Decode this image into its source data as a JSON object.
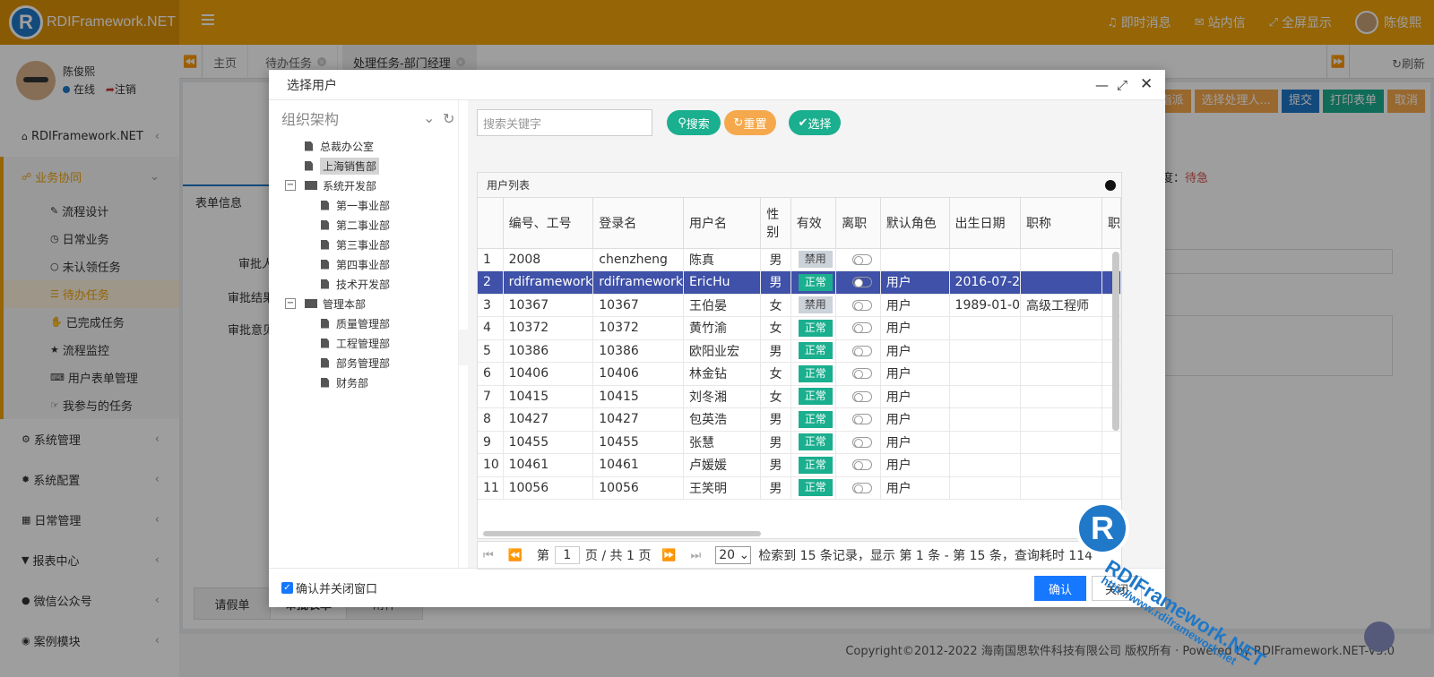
{
  "app": {
    "logo_letter": "R",
    "title": "RDIFramework.NET"
  },
  "top_nav": {
    "messages": "即时消息",
    "mail": "站内信",
    "fullscreen": "全屏显示",
    "user": "陈俊熙"
  },
  "user_panel": {
    "name": "陈俊熙",
    "status": "在线",
    "logout": "注销"
  },
  "sidebar": {
    "top_item": "RDIFramework.NET",
    "group": "业务协同",
    "sub_items": [
      "流程设计",
      "日常业务",
      "未认领任务",
      "待办任务",
      "已完成任务",
      "流程监控",
      "用户表单管理",
      "我参与的任务"
    ],
    "items": [
      "系统管理",
      "系统配置",
      "日常管理",
      "报表中心",
      "微信公众号",
      "案例模块"
    ]
  },
  "tabs": [
    "主页",
    "待办任务",
    "处理任务-部门经理"
  ],
  "refresh_label": "刷新",
  "content": {
    "buttons": [
      "指派",
      "选择处理人...",
      "提交",
      "打印表单",
      "取消"
    ],
    "form_tab": "表单信息",
    "priority_label": "度：",
    "priority_value": "待急",
    "labels": [
      "审批人",
      "审批结果",
      "审批意见"
    ],
    "bottom_tabs": [
      "请假单",
      "审批表单",
      "附件"
    ]
  },
  "footer": {
    "copyright": "Copyright©2012-2022 海南国思软件科技有限公司 版权所有 · Powered by RDIFramework.NET-V5.0"
  },
  "modal": {
    "title": "选择用户",
    "org_title": "组织架构",
    "tree": {
      "root_docs": [
        "总裁办公室",
        "上海销售部"
      ],
      "dev": {
        "name": "系统开发部",
        "children": [
          "第一事业部",
          "第二事业部",
          "第三事业部",
          "第四事业部",
          "技术开发部"
        ]
      },
      "mgmt": {
        "name": "管理本部",
        "children": [
          "质量管理部",
          "工程管理部",
          "部务管理部",
          "财务部"
        ]
      }
    },
    "search": {
      "placeholder": "搜索关键字",
      "search_btn": "搜索",
      "reset_btn": "重置",
      "select_btn": "选择"
    },
    "grid": {
      "title": "用户列表",
      "columns": [
        "",
        "编号、工号",
        "登录名",
        "用户名",
        "性别",
        "有效",
        "离职",
        "默认角色",
        "出生日期",
        "职称",
        "职"
      ],
      "rows": [
        [
          "1",
          "2008",
          "chenzheng",
          "陈真",
          "男",
          "禁用",
          "",
          "",
          ""
        ],
        [
          "2",
          "rdiframework",
          "rdiframework",
          "EricHu",
          "男",
          "正常",
          "用户",
          "2016-07-2",
          ""
        ],
        [
          "3",
          "10367",
          "10367",
          "王伯晏",
          "女",
          "禁用",
          "用户",
          "1989-01-0",
          "高级工程师"
        ],
        [
          "4",
          "10372",
          "10372",
          "黄竹渝",
          "女",
          "正常",
          "用户",
          "",
          ""
        ],
        [
          "5",
          "10386",
          "10386",
          "欧阳业宏",
          "男",
          "正常",
          "用户",
          "",
          ""
        ],
        [
          "6",
          "10406",
          "10406",
          "林金钻",
          "女",
          "正常",
          "用户",
          "",
          ""
        ],
        [
          "7",
          "10415",
          "10415",
          "刘冬湘",
          "女",
          "正常",
          "用户",
          "",
          ""
        ],
        [
          "8",
          "10427",
          "10427",
          "包英浩",
          "男",
          "正常",
          "用户",
          "",
          ""
        ],
        [
          "9",
          "10455",
          "10455",
          "张慧",
          "男",
          "正常",
          "用户",
          "",
          ""
        ],
        [
          "10",
          "10461",
          "10461",
          "卢媛媛",
          "男",
          "正常",
          "用户",
          "",
          ""
        ],
        [
          "11",
          "10056",
          "10056",
          "王笑明",
          "男",
          "正常",
          "用户",
          "",
          ""
        ]
      ],
      "selected_row": 2
    },
    "pager": {
      "page_label": "第",
      "page": "1",
      "page_total": "页 / 共 1 页",
      "page_size": "20",
      "summary": "检索到 15 条记录，显示 第 1 条 - 第 15 条，查询耗时 114"
    },
    "footer": {
      "checkbox_label": "确认并关闭窗口",
      "confirm": "确认",
      "close": "关闭"
    }
  },
  "watermark": {
    "text": "RDIFramework.NET",
    "url": "http://www.rdiframework.net"
  },
  "colors": {
    "brand": "#f0a30a",
    "teal": "#1aaf8e",
    "orange": "#f5a94c",
    "blue": "#1f78c8",
    "selected_row": "#3f51a8"
  }
}
